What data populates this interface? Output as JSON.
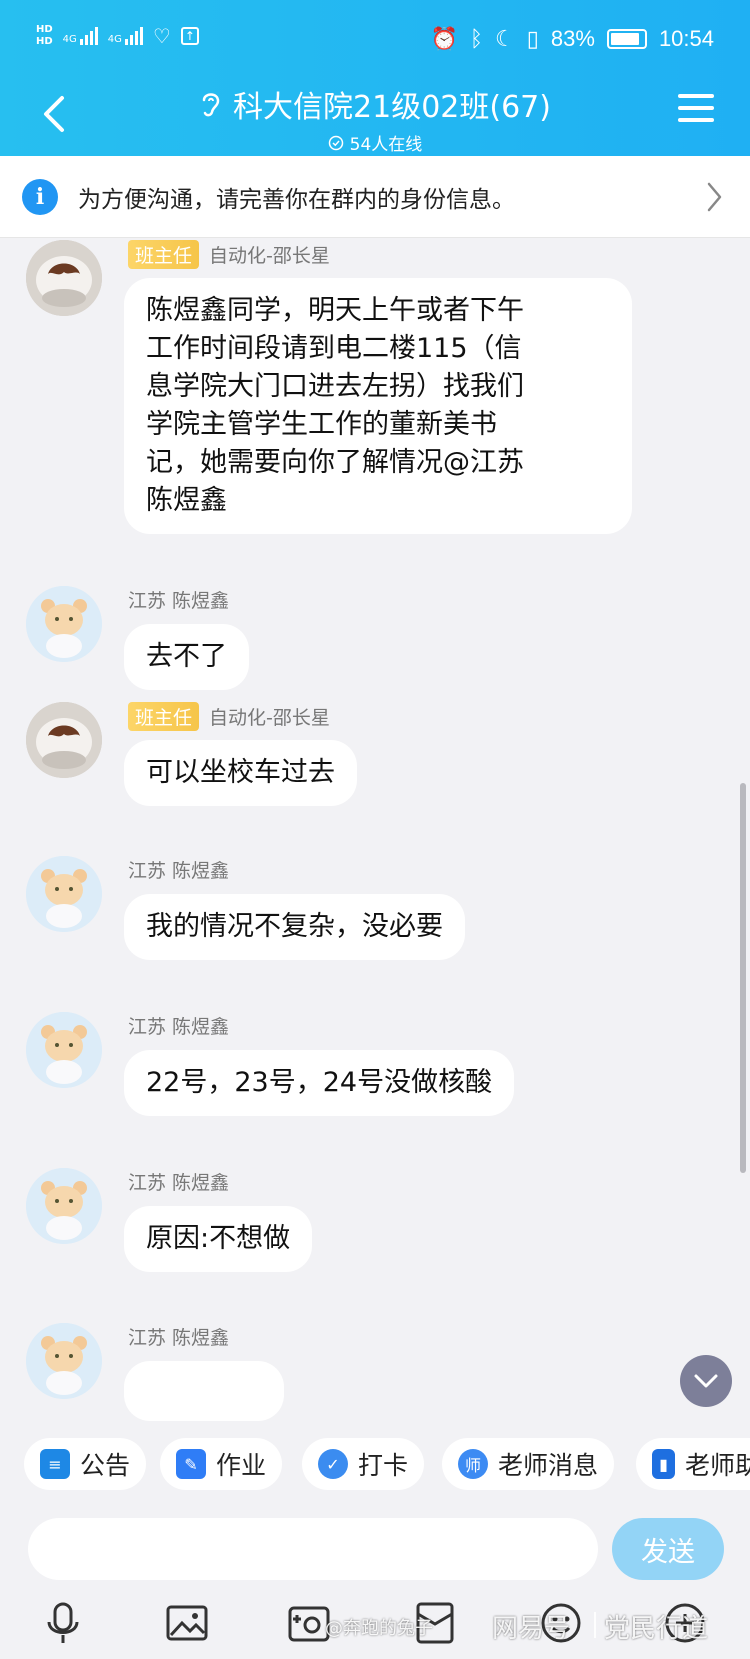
{
  "status_bar": {
    "hd1": "HD",
    "hd2": "HD",
    "net1": "4G",
    "net2": "4G",
    "battery_percent": "83%",
    "time": "10:54"
  },
  "header": {
    "title": "科大信院21级02班(67)",
    "online": "54人在线"
  },
  "notice": {
    "text": "为方便沟通，请完善你在群内的身份信息。"
  },
  "messages": [
    {
      "tag": "班主任",
      "sender": "自动化-邵长星",
      "avatar": "teacher",
      "lines": [
        "陈煜鑫同学，明天上午或者下午",
        "工作时间段请到电二楼115（信",
        "息学院大门口进去左拐）找我们",
        "学院主管学生工作的董新美书",
        "记，她需要向你了解情况@江苏",
        "陈煜鑫"
      ]
    },
    {
      "tag": "",
      "sender": "江苏  陈煜鑫",
      "avatar": "student",
      "lines": [
        "去不了"
      ]
    },
    {
      "tag": "班主任",
      "sender": "自动化-邵长星",
      "avatar": "teacher",
      "lines": [
        "可以坐校车过去"
      ]
    },
    {
      "tag": "",
      "sender": "江苏  陈煜鑫",
      "avatar": "student",
      "lines": [
        "我的情况不复杂，没必要"
      ]
    },
    {
      "tag": "",
      "sender": "江苏  陈煜鑫",
      "avatar": "student",
      "lines": [
        "22号，23号，24号没做核酸"
      ]
    },
    {
      "tag": "",
      "sender": "江苏  陈煜鑫",
      "avatar": "student",
      "lines": [
        "原因:不想做"
      ]
    },
    {
      "tag": "",
      "sender": "江苏  陈煜鑫",
      "avatar": "student",
      "lines": []
    }
  ],
  "tools": [
    {
      "label": "公告",
      "icon": "announcement-icon",
      "color": "#1e88e5"
    },
    {
      "label": "作业",
      "icon": "homework-icon",
      "color": "#2f7df6"
    },
    {
      "label": "打卡",
      "icon": "checkin-icon",
      "color": "#3b8cf0"
    },
    {
      "label": "老师消息",
      "icon": "teacher-message-icon",
      "color": "#3d8bf3"
    },
    {
      "label": "老师助",
      "icon": "teacher-assistant-icon",
      "color": "#1e6fe0"
    }
  ],
  "input": {
    "placeholder": "",
    "send_label": "发送"
  },
  "bottom_icons": [
    "microphone-icon",
    "image-icon",
    "camera-icon",
    "red-packet-icon",
    "emoji-icon",
    "plus-icon"
  ],
  "watermarks": {
    "weibo": "@奔跑的兔子",
    "netease": "网易号",
    "channel": "党民行道"
  },
  "colors": {
    "header": "#1fb0f3",
    "tag": "#f6c54a",
    "send": "#93d4f6"
  }
}
